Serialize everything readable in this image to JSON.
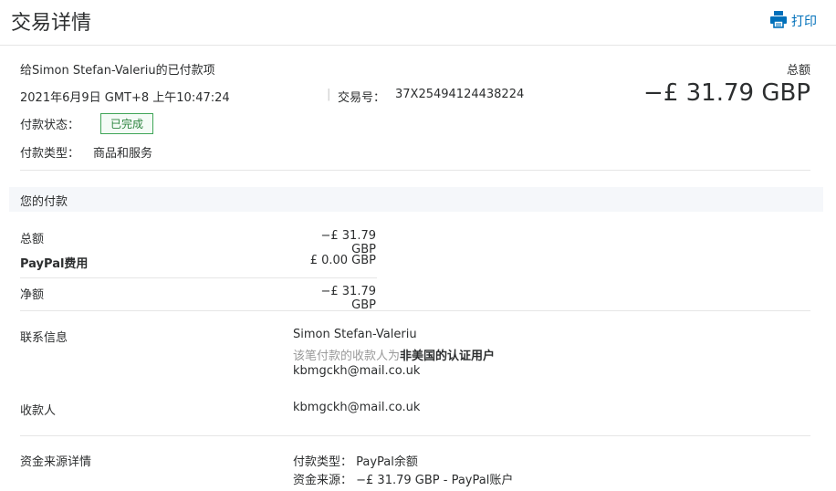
{
  "header": {
    "title": "交易详情",
    "print_label": "打印",
    "print_icon": "printer-icon",
    "accent": "#0070ba"
  },
  "summary": {
    "title": "给Simon Stefan-Valeriu的已付款项",
    "date": "2021年6月9日 GMT+8 上午10:47:24",
    "separator": "|",
    "tx_label": "交易号：",
    "tx_id": "37X25494124438224",
    "total_label": "总额",
    "total_amount": "−£ 31.79 GBP",
    "status_label": "付款状态：",
    "status_value": "已完成",
    "status_color": "#2e8540",
    "type_label": "付款类型：",
    "type_value": "商品和服务"
  },
  "payment": {
    "section_title": "您的付款",
    "rows": [
      {
        "label": "总额",
        "value": "−£ 31.79 GBP"
      },
      {
        "label": "PayPal费用",
        "value": "£ 0.00 GBP"
      },
      {
        "label": "净额",
        "value": "−£ 31.79 GBP"
      }
    ]
  },
  "contact": {
    "label": "联系信息",
    "name": "Simon Stefan-Valeriu",
    "note_prefix": "该笔付款的收款人为",
    "note_bold": "非美国的认证用户",
    "email": "kbmgckh@mail.co.uk"
  },
  "payee": {
    "label": "收款人",
    "email": "kbmgckh@mail.co.uk"
  },
  "funding": {
    "label": "资金来源详情",
    "type_line": "付款类型： PayPal余额",
    "source_line": "资金来源： −£ 31.79 GBP - PayPal账户"
  }
}
